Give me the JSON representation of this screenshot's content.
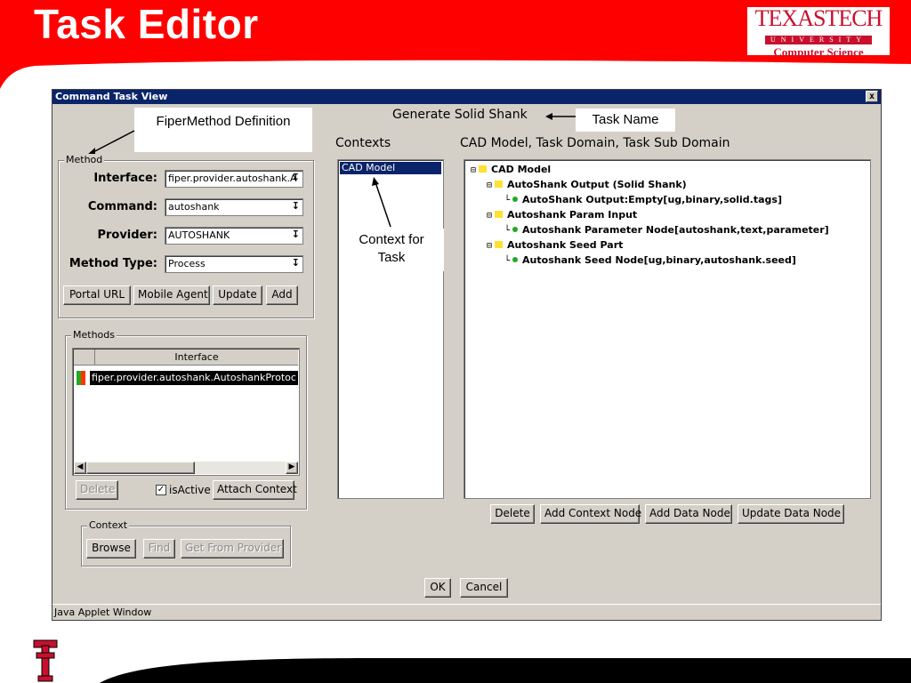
{
  "slide": {
    "title": "Task Editor",
    "logo": {
      "line1": "TEXASTECH",
      "line2": "UNIVERSITY",
      "line3": "Computer Science"
    },
    "colors": {
      "brand_red": "#ff0000",
      "title_bar": "#0a246a",
      "window_bg": "#d4d0c8"
    }
  },
  "window": {
    "title": "Command Task View",
    "close_label": "x",
    "status": "Java Applet Window"
  },
  "annotations": {
    "fiper_method": "FiperMethod Definition",
    "task_name": "Task Name",
    "context_for_task_1": "Context for",
    "context_for_task_2": "Task"
  },
  "task_name_value": "Generate Solid Shank",
  "method": {
    "legend": "Method",
    "fields": [
      {
        "label": "Interface:",
        "value": "fiper.provider.autoshank.A"
      },
      {
        "label": "Command:",
        "value": "autoshank"
      },
      {
        "label": "Provider:",
        "value": "AUTOSHANK"
      },
      {
        "label": "Method Type:",
        "value": "Process"
      }
    ],
    "buttons": {
      "portal_url": "Portal URL",
      "mobile_agent": "Mobile Agent",
      "update": "Update",
      "add": "Add"
    }
  },
  "methods": {
    "legend": "Methods",
    "column": "Interface",
    "rows": [
      {
        "interface": "fiper.provider.autoshank.AutoshankProtoc"
      }
    ],
    "buttons": {
      "delete": "Delete",
      "attach_context": "Attach Context"
    },
    "is_active_label": "isActive",
    "is_active": true
  },
  "context": {
    "legend": "Context",
    "buttons": {
      "browse": "Browse",
      "find": "Find",
      "get_from_provider": "Get From Provider"
    }
  },
  "contexts_panel": {
    "heading": "Contexts",
    "items": [
      "CAD Model"
    ],
    "selected": "CAD Model"
  },
  "tree_panel": {
    "heading": "CAD Model, Task Domain, Task Sub Domain",
    "nodes": {
      "root": "CAD Model",
      "n1": "AutoShank Output (Solid Shank)",
      "n1a": "AutoShank Output:Empty[ug,binary,solid.tags]",
      "n2": "Autoshank Param Input",
      "n2a": "Autoshank Parameter Node[autoshank,text,parameter]",
      "n3": "Autoshank Seed Part",
      "n3a": "Autoshank Seed Node[ug,binary,autoshank.seed]"
    },
    "buttons": {
      "delete": "Delete",
      "add_context_node": "Add Context Node",
      "add_data_node": "Add Data Node",
      "update_data_node": "Update Data Node"
    }
  },
  "dialog_buttons": {
    "ok": "OK",
    "cancel": "Cancel"
  }
}
